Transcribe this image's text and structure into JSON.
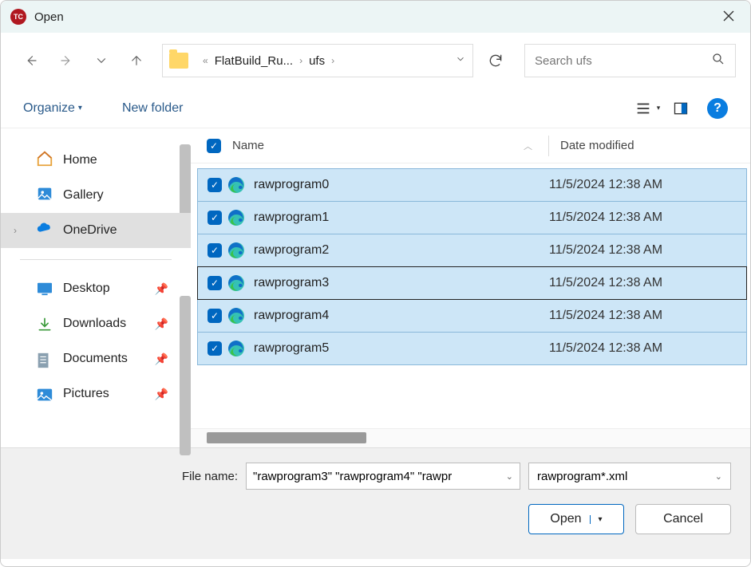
{
  "window": {
    "title": "Open"
  },
  "breadcrumb": {
    "parent": "FlatBuild_Ru...",
    "current": "ufs"
  },
  "search": {
    "placeholder": "Search ufs"
  },
  "toolbar": {
    "organize": "Organize",
    "newfolder": "New folder"
  },
  "sidebar": {
    "home": "Home",
    "gallery": "Gallery",
    "onedrive": "OneDrive",
    "desktop": "Desktop",
    "downloads": "Downloads",
    "documents": "Documents",
    "pictures": "Pictures"
  },
  "columns": {
    "name": "Name",
    "date": "Date modified"
  },
  "files": [
    {
      "name": "rawprogram0",
      "date": "11/5/2024 12:38 AM"
    },
    {
      "name": "rawprogram1",
      "date": "11/5/2024 12:38 AM"
    },
    {
      "name": "rawprogram2",
      "date": "11/5/2024 12:38 AM"
    },
    {
      "name": "rawprogram3",
      "date": "11/5/2024 12:38 AM"
    },
    {
      "name": "rawprogram4",
      "date": "11/5/2024 12:38 AM"
    },
    {
      "name": "rawprogram5",
      "date": "11/5/2024 12:38 AM"
    }
  ],
  "footer": {
    "label": "File name:",
    "value": "\"rawprogram3\" \"rawprogram4\" \"rawpr",
    "filter": "rawprogram*.xml",
    "open": "Open",
    "cancel": "Cancel"
  }
}
